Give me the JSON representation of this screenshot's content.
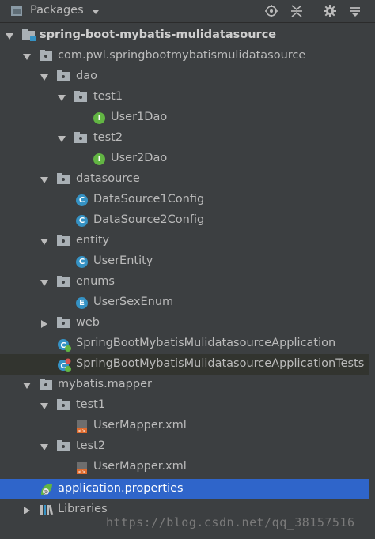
{
  "header": {
    "title": "Packages"
  },
  "tree": [
    {
      "label": "spring-boot-mybatis-mulidatasource",
      "kind": "module",
      "expanded": true
    },
    {
      "label": "com.pwl.springbootmybatismulidatasource",
      "kind": "package",
      "expanded": true
    },
    {
      "label": "dao",
      "kind": "package",
      "expanded": true
    },
    {
      "label": "test1",
      "kind": "package",
      "expanded": true
    },
    {
      "label": "User1Dao",
      "kind": "interface"
    },
    {
      "label": "test2",
      "kind": "package",
      "expanded": true
    },
    {
      "label": "User2Dao",
      "kind": "interface"
    },
    {
      "label": "datasource",
      "kind": "package",
      "expanded": true
    },
    {
      "label": "DataSource1Config",
      "kind": "class"
    },
    {
      "label": "DataSource2Config",
      "kind": "class"
    },
    {
      "label": "entity",
      "kind": "package",
      "expanded": true
    },
    {
      "label": "UserEntity",
      "kind": "class"
    },
    {
      "label": "enums",
      "kind": "package",
      "expanded": true
    },
    {
      "label": "UserSexEnum",
      "kind": "enum"
    },
    {
      "label": "web",
      "kind": "package",
      "expanded": false
    },
    {
      "label": "SpringBootMybatisMulidatasourceApplication",
      "kind": "spring-class"
    },
    {
      "label": "SpringBootMybatisMulidatasourceApplicationTests",
      "kind": "spring-class"
    },
    {
      "label": "mybatis.mapper",
      "kind": "package",
      "expanded": true
    },
    {
      "label": "test1",
      "kind": "package",
      "expanded": true
    },
    {
      "label": "UserMapper.xml",
      "kind": "xml"
    },
    {
      "label": "test2",
      "kind": "package",
      "expanded": true
    },
    {
      "label": "UserMapper.xml",
      "kind": "xml"
    },
    {
      "label": "application.properties",
      "kind": "properties"
    },
    {
      "label": "Libraries",
      "kind": "libraries",
      "expanded": false
    }
  ],
  "watermark": "https://blog.csdn.net/qq_38157516",
  "colors": {
    "background": "#3c3f41",
    "selection": "#2f65ca",
    "class_badge": "#3592c4",
    "interface_badge": "#62b543",
    "folder": "#a9b0b5"
  }
}
